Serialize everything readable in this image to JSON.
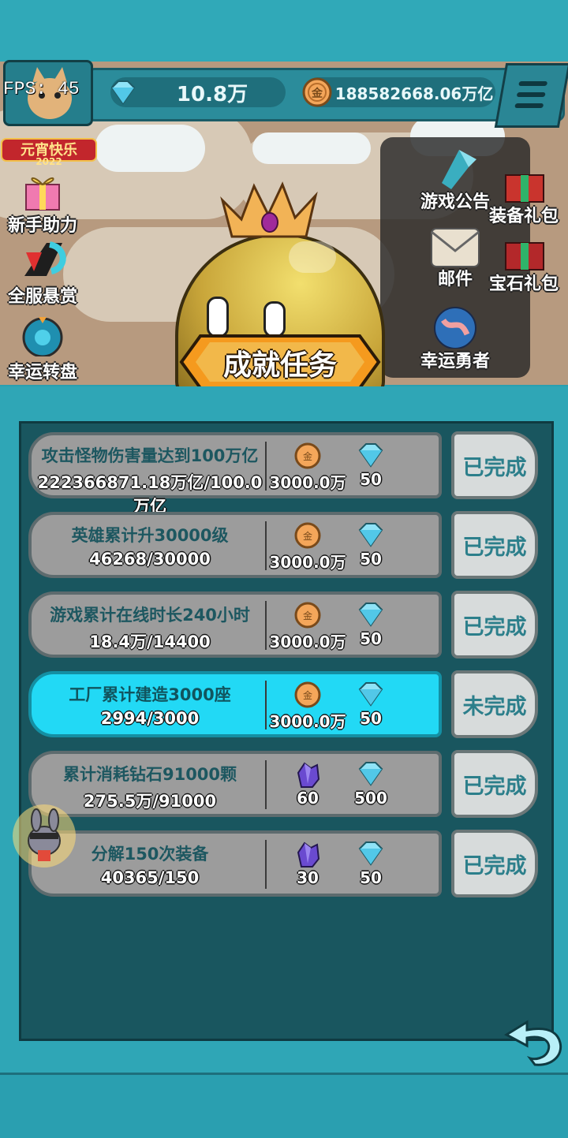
{
  "hud": {
    "fps_label": "FPS:",
    "fps_value": "45",
    "gems": "10.8万",
    "gold": "188582668.06万亿",
    "festival_text": "元宵快乐",
    "festival_year": "2022"
  },
  "left_menu": [
    {
      "label": "新手助力",
      "icon": "gift-icon"
    },
    {
      "label": "全服悬赏",
      "icon": "reward-arrow-icon"
    },
    {
      "label": "幸运转盘",
      "icon": "wheel-icon"
    }
  ],
  "right_menu": [
    {
      "label": "游戏公告",
      "icon": "announcement-icon"
    },
    {
      "label": "邮件",
      "icon": "mail-icon"
    },
    {
      "label": "幸运勇者",
      "icon": "lucky-hero-icon"
    }
  ],
  "right_gifts": [
    {
      "label": "装备礼包",
      "icon": "equipment-gift-icon"
    },
    {
      "label": "宝石礼包",
      "icon": "gem-gift-icon"
    }
  ],
  "title": "成就任务",
  "tasks": [
    {
      "name": "攻击怪物伤害量达到100万亿",
      "progress": "222366871.18万亿/100.0万亿",
      "r1_icon": "gold-coin-icon",
      "r1": "3000.0万",
      "r2_icon": "diamond-icon",
      "r2": "50",
      "status": "已完成",
      "active": false
    },
    {
      "name": "英雄累计升30000级",
      "progress": "46268/30000",
      "r1_icon": "gold-coin-icon",
      "r1": "3000.0万",
      "r2_icon": "diamond-icon",
      "r2": "50",
      "status": "已完成",
      "active": false
    },
    {
      "name": "游戏累计在线时长240小时",
      "progress": "18.4万/14400",
      "r1_icon": "gold-coin-icon",
      "r1": "3000.0万",
      "r2_icon": "diamond-icon",
      "r2": "50",
      "status": "已完成",
      "active": false
    },
    {
      "name": "工厂累计建造3000座",
      "progress": "2994/3000",
      "r1_icon": "gold-coin-icon",
      "r1": "3000.0万",
      "r2_icon": "diamond-icon",
      "r2": "50",
      "status": "未完成",
      "active": true
    },
    {
      "name": "累计消耗钻石91000颗",
      "progress": "275.5万/91000",
      "r1_icon": "purple-crystal-icon",
      "r1": "60",
      "r2_icon": "diamond-icon",
      "r2": "500",
      "status": "已完成",
      "active": false
    },
    {
      "name": "分解150次装备",
      "progress": "40365/150",
      "r1_icon": "purple-crystal-icon",
      "r1": "30",
      "r2_icon": "diamond-icon",
      "r2": "50",
      "status": "已完成",
      "active": false
    }
  ],
  "colors": {
    "panel": "#2fa6b6",
    "inner": "#19565f",
    "active_row": "#22d9f5",
    "inactive_row": "#9c9c9c",
    "status_text": "#2c7f8b"
  }
}
